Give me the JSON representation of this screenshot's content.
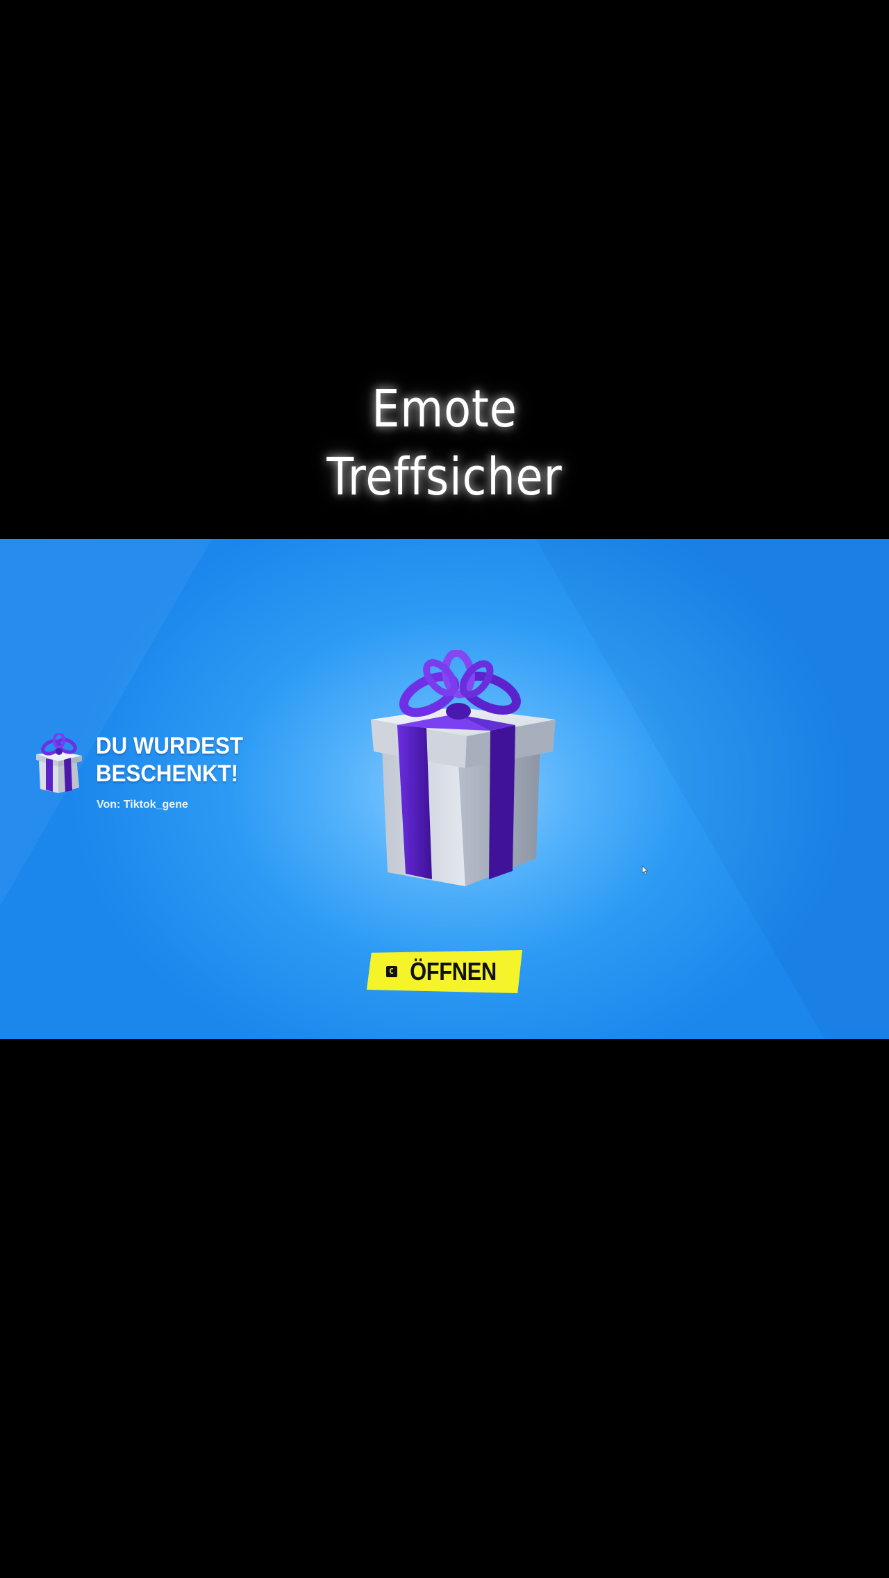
{
  "caption": {
    "line1": "Emote",
    "line2": "Treffsicher"
  },
  "notification": {
    "title": "DU WURDEST\nBESCHENKT!",
    "from": "Von: Tiktok_gene",
    "icon": "gift-icon"
  },
  "gift": {
    "icon": "gift-box-icon",
    "box_color": "#d8dde6",
    "ribbon_color": "#5a22c8"
  },
  "open_button": {
    "key": "C",
    "label": "ÖFFNEN",
    "color": "#f5f32a"
  },
  "colors": {
    "background": "#000000",
    "scene_blue": "#2d9bf4",
    "caption_text": "#ffffff"
  }
}
